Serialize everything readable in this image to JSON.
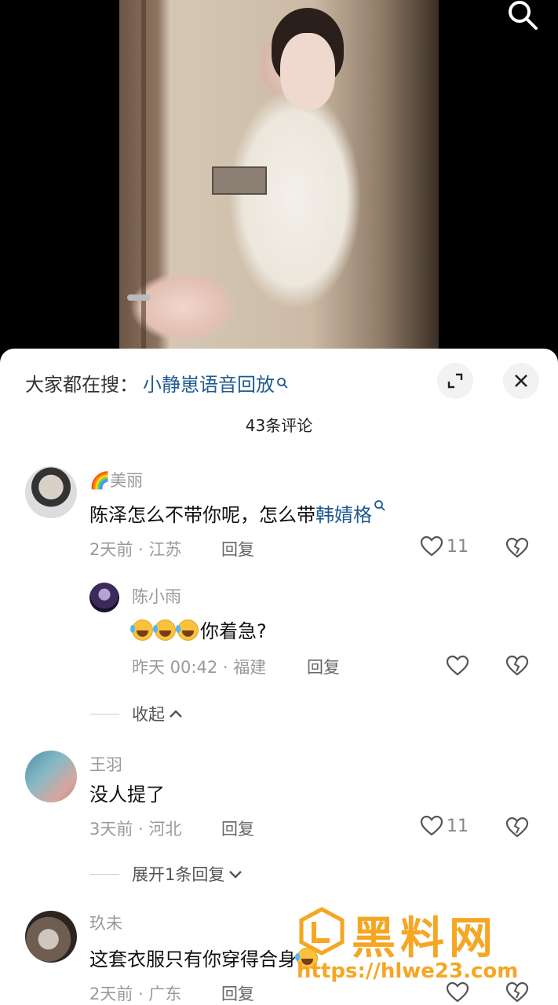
{
  "trend": {
    "prefix": "大家都在搜：",
    "query": "小静崽语音回放"
  },
  "comment_count": "43条评论",
  "comments": [
    {
      "name": "🌈美丽",
      "text_plain": "陈泽怎么不带你呢，怎么带",
      "text_link": "韩婧格",
      "time": "2天前 · 江苏",
      "reply_label": "回复",
      "likes": "11",
      "replies": [
        {
          "name": "陈小雨",
          "text": "你着急?",
          "time": "昨天 00:42 · 福建",
          "reply_label": "回复"
        }
      ],
      "toggle_label": "收起"
    },
    {
      "name": "王羽",
      "text_plain": "没人提了",
      "time": "3天前 · 河北",
      "reply_label": "回复",
      "likes": "11",
      "toggle_label": "展开1条回复"
    },
    {
      "name": "玖未",
      "text_plain": "这套衣服只有你穿得合身",
      "time": "2天前 · 广东",
      "reply_label": "回复"
    }
  ],
  "watermark": {
    "brand": "黑料网",
    "url": "https://hlwe23.com"
  },
  "colors": {
    "link": "#1f5a8f",
    "accent": "#f5a623"
  },
  "icons": [
    "search-icon",
    "expand-icon",
    "close-icon",
    "heart-icon",
    "broken-heart-icon",
    "chevron-up-icon",
    "chevron-down-icon"
  ]
}
